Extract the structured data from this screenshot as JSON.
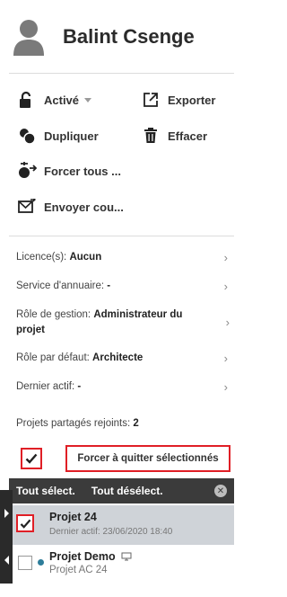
{
  "user": {
    "name": "Balint Csenge"
  },
  "actions": {
    "activate_label": "Activé",
    "export_label": "Exporter",
    "duplicate_label": "Dupliquer",
    "delete_label": "Effacer",
    "force_all_label": "Forcer tous ...",
    "send_label": "Envoyer cou..."
  },
  "info": {
    "license_key": "Licence(s):",
    "license_val": "Aucun",
    "directory_key": "Service d'annuaire:",
    "directory_val": "-",
    "mgmt_role_key": "Rôle de gestion:",
    "mgmt_role_val": "Administrateur du projet",
    "default_role_key": "Rôle par défaut:",
    "default_role_val": "Architecte",
    "last_active_key": "Dernier actif:",
    "last_active_val": "-",
    "shared_key": "Projets partagés rejoints:",
    "shared_val": "2"
  },
  "force_selected_label": "Forcer à quitter sélectionnés",
  "selection_bar": {
    "select_all": "Tout sélect.",
    "deselect_all": "Tout désélect."
  },
  "projects": [
    {
      "name": "Projet 24",
      "sub": "Dernier actif: 23/06/2020 18:40",
      "checked": true,
      "dot_color": "#cfd3d8"
    },
    {
      "name": "Projet Demo",
      "sub": "Projet AC 24",
      "checked": false,
      "dot_color": "#2e7d9a"
    }
  ],
  "colors": {
    "accent_red": "#e01f26",
    "dark_bar": "#3b3b3b",
    "selected_row": "#cfd3d8"
  },
  "icons": [
    "user-avatar-icon",
    "unlock-icon",
    "export-icon",
    "duplicate-icon",
    "trash-icon",
    "force-leave-icon",
    "send-mail-icon",
    "chevron-right-icon",
    "checkmark-icon",
    "close-icon",
    "monitor-icon"
  ]
}
